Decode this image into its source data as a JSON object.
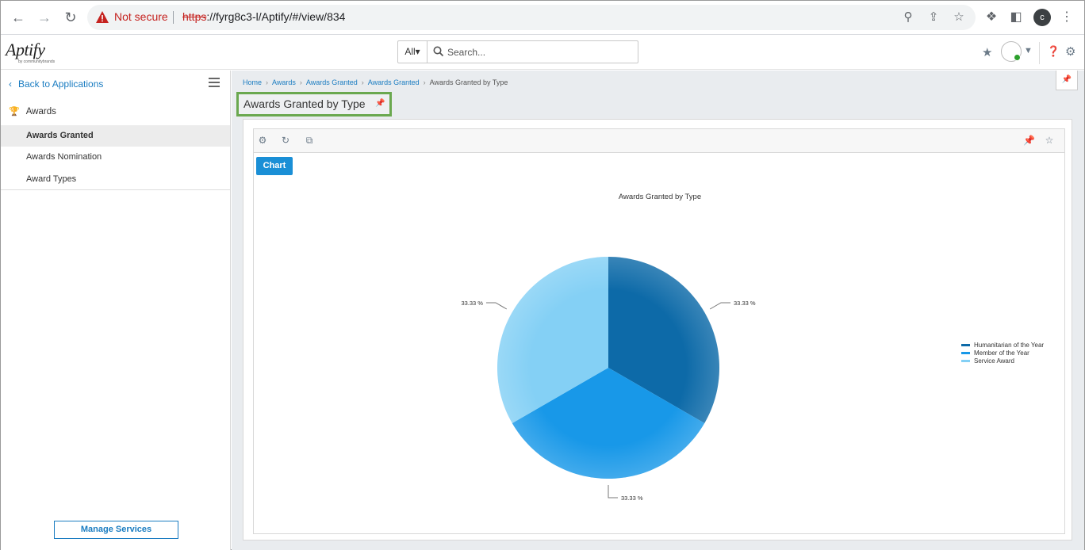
{
  "browser": {
    "not_secure": "Not secure",
    "url_scheme": "https",
    "url_rest": "://fyrg8c3-l/Aptify/#/view/834",
    "profile_initial": "c"
  },
  "header": {
    "logo": "Aptify",
    "logo_sub": "by communitybrands",
    "search_scope": "All▾",
    "search_placeholder": "Search..."
  },
  "sidebar": {
    "back_label": "Back to Applications",
    "section_label": "Awards",
    "items": [
      {
        "label": "Awards Granted",
        "active": true
      },
      {
        "label": "Awards Nomination",
        "active": false
      },
      {
        "label": "Award Types",
        "active": false
      }
    ],
    "manage_label": "Manage Services"
  },
  "main": {
    "breadcrumb": [
      "Home",
      "Awards",
      "Awards Granted",
      "Awards Granted",
      "Awards Granted by Type"
    ],
    "page_title": "Awards Granted by Type",
    "chart_tab": "Chart"
  },
  "chart_data": {
    "type": "pie",
    "title": "Awards Granted by Type",
    "categories": [
      "Humanitarian of the Year",
      "Member of the Year",
      "Service Award"
    ],
    "values": [
      33.33,
      33.33,
      33.33
    ],
    "labels": [
      "33.33 %",
      "33.33 %",
      "33.33 %"
    ],
    "colors": [
      "#0d6aa8",
      "#1898e8",
      "#84d0f5"
    ],
    "legend_position": "right"
  }
}
